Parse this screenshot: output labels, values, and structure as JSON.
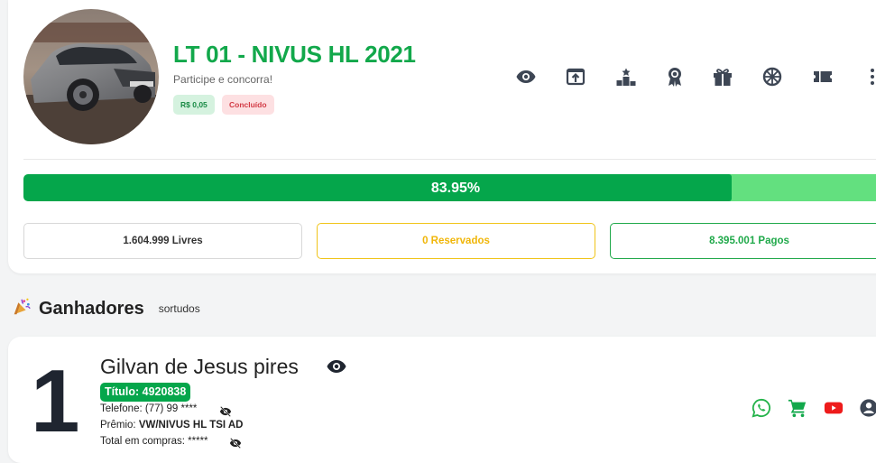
{
  "raffle": {
    "title": "LT 01 - NIVUS HL 2021",
    "subtitle": "Participe e concorra!",
    "price_badge": "R$ 0,05",
    "status_badge": "Concluído",
    "image_alt": "VW Nivus car photo"
  },
  "toolbar_icons": [
    "eye-icon",
    "share-icon",
    "ranking-icon",
    "award-icon",
    "gift-icon",
    "wheel-icon",
    "ticket-icon",
    "more-vertical-icon"
  ],
  "progress": {
    "percent": 83.95,
    "label": "83.95%"
  },
  "stats": {
    "livres": "1.604.999 Livres",
    "reservados": "0 Reservados",
    "pagos": "8.395.001 Pagos"
  },
  "winners": {
    "title": "Ganhadores",
    "subtitle": "sortudos",
    "items": [
      {
        "place": "1",
        "name": "Gilvan de Jesus pires",
        "ticket": "Título: 4920838",
        "phone_label": "Telefone: (77) 99 ****",
        "prize_label": "Prêmio: ",
        "prize_value": "VW/NIVUS HL TSI AD",
        "total_label": "Total em compras: *****"
      }
    ]
  },
  "colors": {
    "brand_green": "#12a84b",
    "progress_fill": "#05a64b",
    "progress_track": "#63e07f",
    "reserved_yellow": "#f0b609",
    "status_red": "#d33a45",
    "icon_gray": "#3d4654"
  }
}
